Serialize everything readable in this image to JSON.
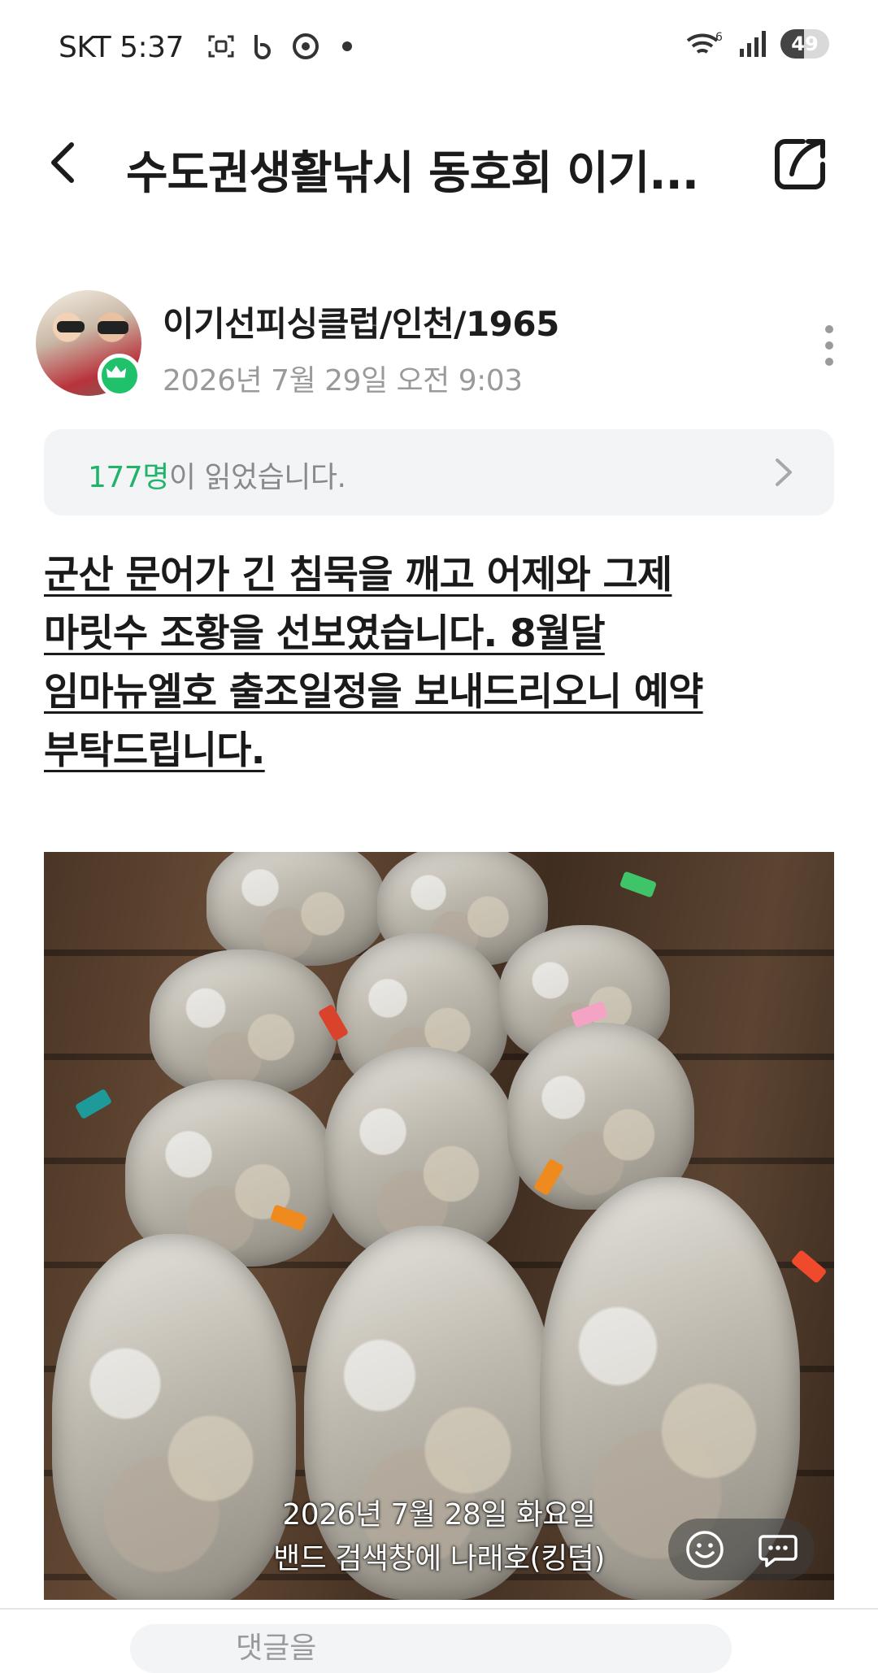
{
  "status_bar": {
    "carrier": "SKT",
    "time": "5:37",
    "battery_level": "49",
    "battery_fraction": 0.49,
    "wifi_badge": "6",
    "icons": [
      "screenshot-icon",
      "band-icon",
      "chrome-icon",
      "notification-dot-icon",
      "wifi-icon",
      "signal-icon"
    ]
  },
  "header": {
    "title": "수도권생활낚시 동호회 이기...",
    "back_icon": "back-arrow-icon",
    "share_icon": "share-icon"
  },
  "post": {
    "author_name": "이기선피싱클럽/인천/1965",
    "date": "2026년 7월 29일 오전 9:03",
    "readers_count": "177명",
    "readers_suffix": "이 읽었습니다.",
    "body_lines": [
      "군산 문어가 긴 침묵을 깨고 어제와 그제",
      " 마릿수 조황을 선보였습니다. 8월달",
      " 임마뉴엘호 출조일정을 보내드리오니 예약",
      " 부탁드립니다."
    ],
    "photo_caption_line1": "2026년 7월 28일 화요일",
    "photo_caption_line2": "밴드 검색창에 나래호(킹덤)"
  },
  "bottom_bar": {
    "comment_placeholder": "댓글을"
  },
  "colors": {
    "accent_green": "#1fb46a",
    "badge_green": "#1fc26b",
    "panel_bg": "#f3f4f6"
  }
}
